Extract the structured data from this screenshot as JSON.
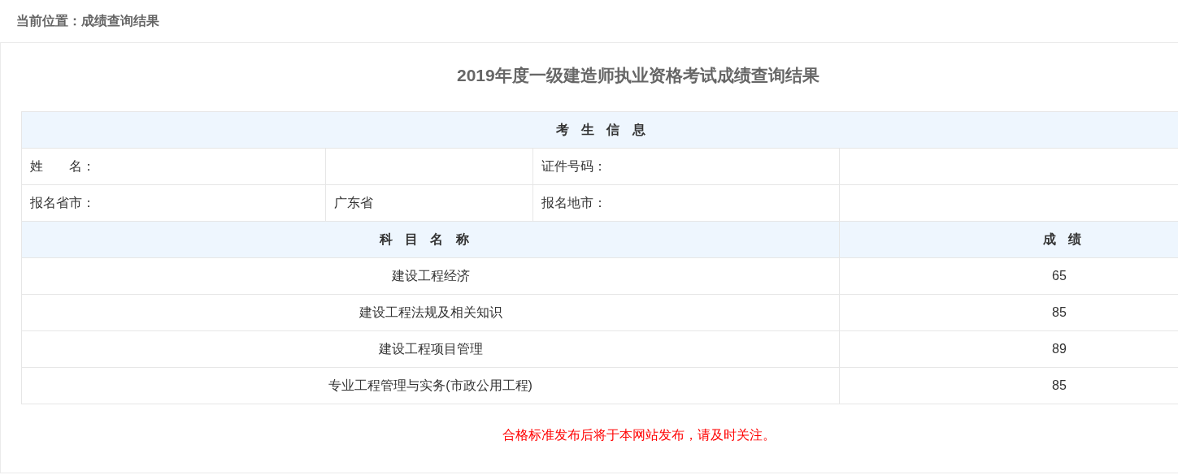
{
  "breadcrumb": "当前位置：成绩查询结果",
  "title": "2019年度一级建造师执业资格考试成绩查询结果",
  "info_section": {
    "heading": "考生信息",
    "rows": [
      {
        "label_1": "姓　　名：",
        "value_1": "",
        "label_2": "证件号码：",
        "value_2": ""
      },
      {
        "label_1": "报名省市：",
        "value_1": "广东省",
        "label_2": "报名地市：",
        "value_2": ""
      }
    ]
  },
  "scores": {
    "columns": [
      "科目名称",
      "成绩"
    ],
    "rows": [
      {
        "subject": "建设工程经济",
        "score": "65"
      },
      {
        "subject": "建设工程法规及相关知识",
        "score": "85"
      },
      {
        "subject": "建设工程项目管理",
        "score": "89"
      },
      {
        "subject": "专业工程管理与实务(市政公用工程)",
        "score": "85"
      }
    ]
  },
  "notice": "合格标准发布后将于本网站发布，请及时关注。"
}
